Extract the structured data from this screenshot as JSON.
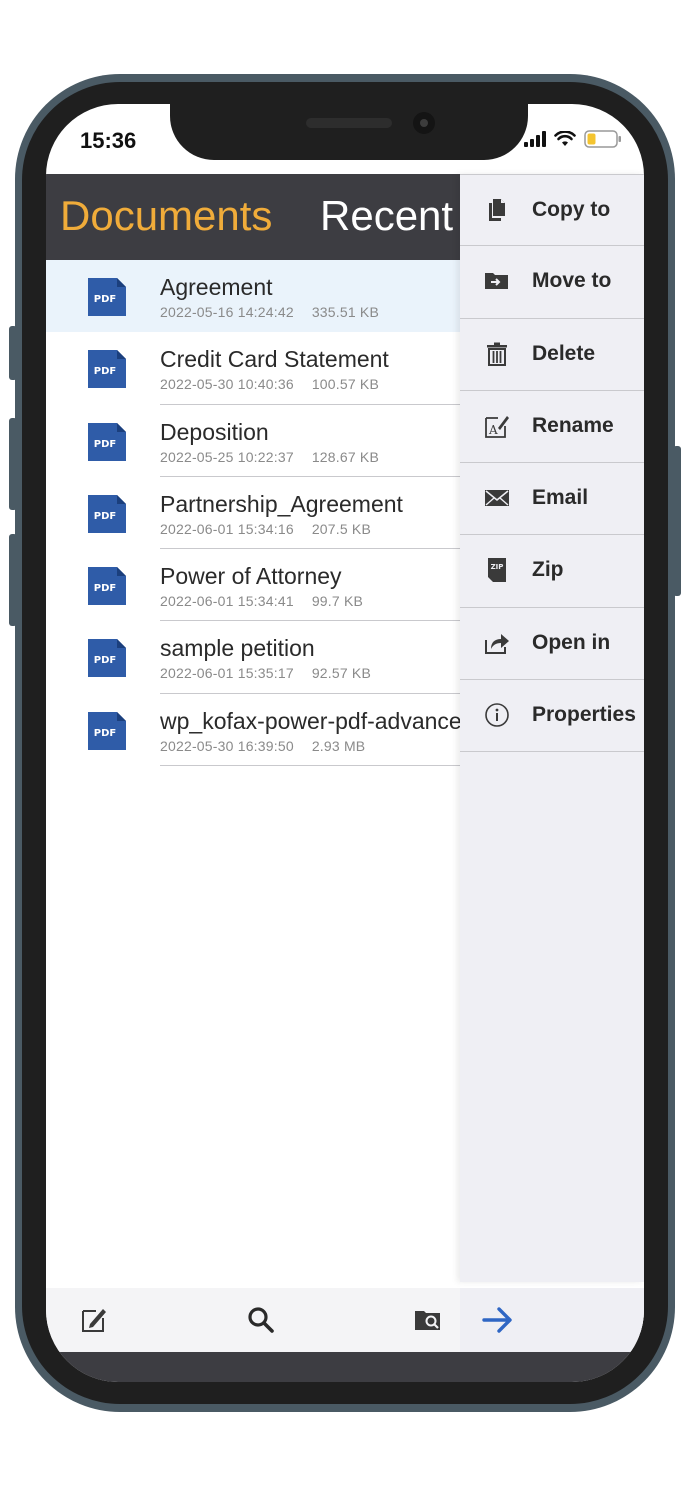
{
  "status_bar": {
    "time": "15:36"
  },
  "tabs": {
    "documents": "Documents",
    "recent": "Recent"
  },
  "files": [
    {
      "name": "Agreement",
      "date": "2022-05-16 14:24:42",
      "size": "335.51 KB",
      "selected": true
    },
    {
      "name": "Credit Card Statement",
      "date": "2022-05-30 10:40:36",
      "size": "100.57 KB"
    },
    {
      "name": "Deposition",
      "date": "2022-05-25 10:22:37",
      "size": "128.67 KB"
    },
    {
      "name": "Partnership_Agreement",
      "date": "2022-06-01 15:34:16",
      "size": "207.5 KB"
    },
    {
      "name": "Power of Attorney",
      "date": "2022-06-01 15:34:41",
      "size": "99.7 KB"
    },
    {
      "name": "sample petition",
      "date": "2022-06-01 15:35:17",
      "size": "92.57 KB"
    },
    {
      "name": "wp_kofax-power-pdf-advanced",
      "date": "2022-05-30 16:39:50",
      "size": "2.93 MB"
    }
  ],
  "file_icon_label": "PDF",
  "menu": [
    {
      "label": "Copy to",
      "icon": "copy-icon"
    },
    {
      "label": "Move to",
      "icon": "folder-move-icon"
    },
    {
      "label": "Delete",
      "icon": "trash-icon"
    },
    {
      "label": "Rename",
      "icon": "rename-icon"
    },
    {
      "label": "Email",
      "icon": "envelope-icon"
    },
    {
      "label": "Zip",
      "icon": "zip-icon"
    },
    {
      "label": "Open in",
      "icon": "share-icon"
    },
    {
      "label": "Properties",
      "icon": "info-icon"
    }
  ],
  "toolbar": {
    "edit_icon": "edit-icon",
    "search_icon": "search-icon",
    "folder_search_icon": "folder-search-icon",
    "close_menu_icon": "arrow-right-icon"
  },
  "colors": {
    "accent": "#f0ac3a",
    "header_bg": "#3d3d42",
    "selected_row": "#eaf3fb",
    "pdf_blue": "#2f5ca8",
    "arrow_blue": "#2f66c4"
  }
}
